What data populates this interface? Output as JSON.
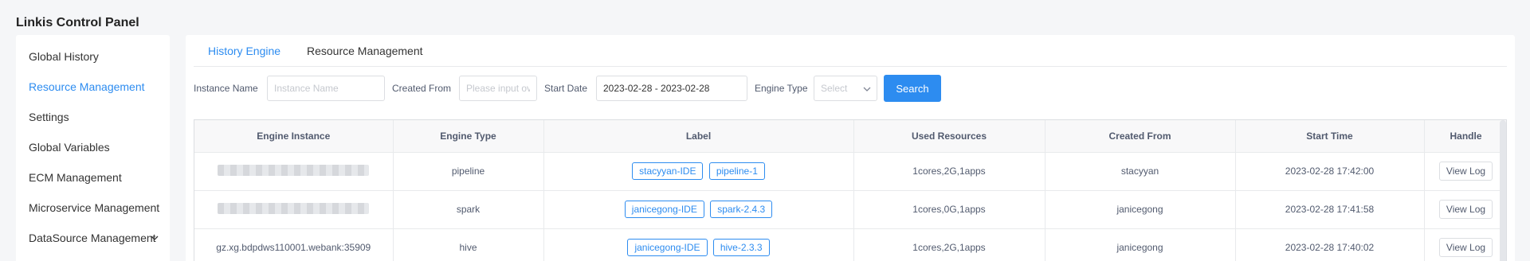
{
  "app": {
    "title": "Linkis Control Panel"
  },
  "sidebar": {
    "items": [
      {
        "label": "Global History",
        "active": false
      },
      {
        "label": "Resource Management",
        "active": true
      },
      {
        "label": "Settings",
        "active": false
      },
      {
        "label": "Global Variables",
        "active": false
      },
      {
        "label": "ECM Management",
        "active": false
      },
      {
        "label": "Microservice Management",
        "active": false
      },
      {
        "label": "DataSource Management",
        "active": false,
        "expandable": true
      }
    ]
  },
  "tabs": [
    {
      "label": "History Engine",
      "active": true
    },
    {
      "label": "Resource Management",
      "active": false
    }
  ],
  "filters": {
    "instance_name": {
      "label": "Instance Name",
      "placeholder": "Instance Name",
      "value": ""
    },
    "created_from": {
      "label": "Created From",
      "placeholder": "Please input ov",
      "value": ""
    },
    "start_date": {
      "label": "Start Date",
      "value": "2023-02-28 - 2023-02-28"
    },
    "engine_type": {
      "label": "Engine Type",
      "placeholder": "Select"
    },
    "search_label": "Search"
  },
  "colors": {
    "accent": "#2d8cf0",
    "border": "#dcdee2",
    "header_bg": "#f8f8f9"
  },
  "table": {
    "columns": [
      "Engine Instance",
      "Engine Type",
      "Label",
      "Used Resources",
      "Created From",
      "Start Time",
      "Handle"
    ],
    "rows": [
      {
        "instance": "",
        "instance_redacted": true,
        "engine_type": "pipeline",
        "labels": [
          "stacyyan-IDE",
          "pipeline-1"
        ],
        "resources": "1cores,2G,1apps",
        "created_from": "stacyyan",
        "start_time": "2023-02-28 17:42:00",
        "handle": "View Log"
      },
      {
        "instance": "",
        "instance_redacted": true,
        "engine_type": "spark",
        "labels": [
          "janicegong-IDE",
          "spark-2.4.3"
        ],
        "resources": "1cores,0G,1apps",
        "created_from": "janicegong",
        "start_time": "2023-02-28 17:41:58",
        "handle": "View Log"
      },
      {
        "instance": "gz.xg.bdpdws110001.webank:35909",
        "instance_redacted": false,
        "engine_type": "hive",
        "labels": [
          "janicegong-IDE",
          "hive-2.3.3"
        ],
        "resources": "1cores,2G,1apps",
        "created_from": "janicegong",
        "start_time": "2023-02-28 17:40:02",
        "handle": "View Log"
      }
    ]
  }
}
